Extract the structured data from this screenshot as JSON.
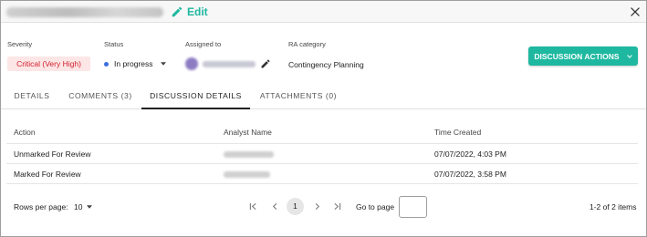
{
  "header": {
    "edit_label": "Edit"
  },
  "meta": {
    "severity_label": "Severity",
    "severity_value": "Critical (Very High)",
    "status_label": "Status",
    "status_value": "In progress",
    "assigned_label": "Assigned to",
    "ra_label": "RA category",
    "ra_value": "Contingency Planning",
    "actions_label": "DISCUSSION ACTIONS"
  },
  "tabs": [
    {
      "label": "DETAILS"
    },
    {
      "label": "COMMENTS (3)"
    },
    {
      "label": "DISCUSSION DETAILS"
    },
    {
      "label": "ATTACHMENTS (0)"
    }
  ],
  "table": {
    "columns": [
      "Action",
      "Analyst Name",
      "Time Created"
    ],
    "rows": [
      {
        "action": "Unmarked For Review",
        "time": "07/07/2022, 4:03 PM"
      },
      {
        "action": "Marked For Review",
        "time": "07/07/2022, 3:58 PM"
      }
    ]
  },
  "footer": {
    "rows_per_page_label": "Rows per page:",
    "rows_per_page_value": "10",
    "current_page": "1",
    "goto_label": "Go to page",
    "items_count": "1-2 of 2 items"
  },
  "colors": {
    "accent": "#1eb8a0",
    "severity_text": "#d0202d",
    "severity_bg": "#fde6e6",
    "status_dot": "#3d6ee0"
  },
  "icons": [
    "pencil-icon",
    "close-icon",
    "chevron-down-icon",
    "first-page-icon",
    "prev-page-icon",
    "next-page-icon",
    "last-page-icon"
  ]
}
